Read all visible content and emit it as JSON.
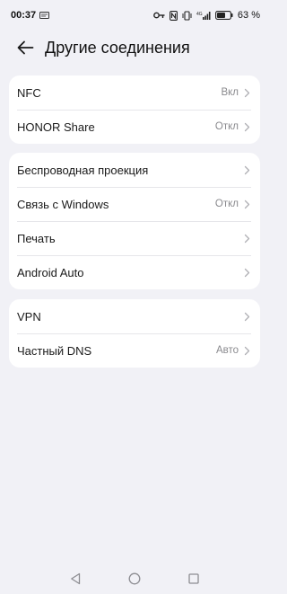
{
  "status_bar": {
    "time": "00:37",
    "battery_percent": "63 %",
    "icons": [
      "message-icon",
      "key-icon",
      "nfc-icon",
      "vibrate-icon",
      "signal-4g-icon",
      "battery-icon"
    ],
    "network_label": "4G"
  },
  "header": {
    "title": "Другие соединения",
    "back_icon": "arrow-left-icon"
  },
  "groups": [
    {
      "rows": [
        {
          "label": "NFC",
          "value": "Вкл"
        },
        {
          "label": "HONOR Share",
          "value": "Откл"
        }
      ]
    },
    {
      "rows": [
        {
          "label": "Беспроводная проекция",
          "value": ""
        },
        {
          "label": "Связь с Windows",
          "value": "Откл"
        },
        {
          "label": "Печать",
          "value": ""
        },
        {
          "label": "Android Auto",
          "value": ""
        }
      ]
    },
    {
      "rows": [
        {
          "label": "VPN",
          "value": ""
        },
        {
          "label": "Частный DNS",
          "value": "Авто"
        }
      ]
    }
  ],
  "nav_bar": {
    "icons": [
      "back-triangle-icon",
      "home-circle-icon",
      "recents-square-icon"
    ]
  },
  "colors": {
    "background": "#f1f1f6",
    "card": "#ffffff",
    "secondary_text": "#8a8a8e"
  }
}
